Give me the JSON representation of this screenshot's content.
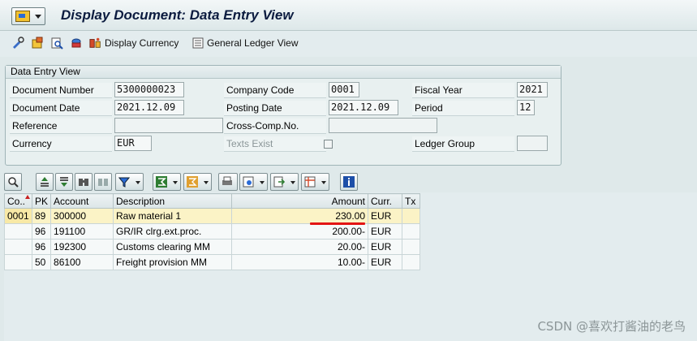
{
  "window": {
    "title": "Display Document: Data Entry View"
  },
  "toolbar": {
    "display_currency_label": "Display Currency",
    "general_ledger_view_label": "General Ledger View"
  },
  "panel": {
    "title": "Data Entry View",
    "fields": {
      "document_number_label": "Document Number",
      "document_number_value": "5300000023",
      "company_code_label": "Company Code",
      "company_code_value": "0001",
      "fiscal_year_label": "Fiscal Year",
      "fiscal_year_value": "2021",
      "document_date_label": "Document Date",
      "document_date_value": "2021.12.09",
      "posting_date_label": "Posting Date",
      "posting_date_value": "2021.12.09",
      "period_label": "Period",
      "period_value": "12",
      "reference_label": "Reference",
      "cross_comp_label": "Cross-Comp.No.",
      "currency_label": "Currency",
      "currency_value": "EUR",
      "texts_exist_label": "Texts Exist",
      "ledger_group_label": "Ledger Group"
    }
  },
  "grid": {
    "headers": [
      "Co..",
      "PK",
      "Account",
      "Description",
      "Amount",
      "Curr.",
      "Tx"
    ],
    "rows": [
      {
        "co": "0001",
        "pk": "89",
        "account": "300000",
        "description": "Raw material 1",
        "amount": "230.00",
        "curr": "EUR",
        "tx": ""
      },
      {
        "co": "",
        "pk": "96",
        "account": "191100",
        "description": "GR/IR clrg.ext.proc.",
        "amount": "200.00-",
        "curr": "EUR",
        "tx": ""
      },
      {
        "co": "",
        "pk": "96",
        "account": "192300",
        "description": "Customs clearing MM",
        "amount": "20.00-",
        "curr": "EUR",
        "tx": ""
      },
      {
        "co": "",
        "pk": "50",
        "account": "86100",
        "description": "Freight provision MM",
        "amount": "10.00-",
        "curr": "EUR",
        "tx": ""
      }
    ]
  },
  "watermark": "CSDN @喜欢打酱油的老鸟",
  "colors": {
    "background": "#dfe9ea",
    "key_cell": "#f8e9a6",
    "underline": "#e31414"
  }
}
